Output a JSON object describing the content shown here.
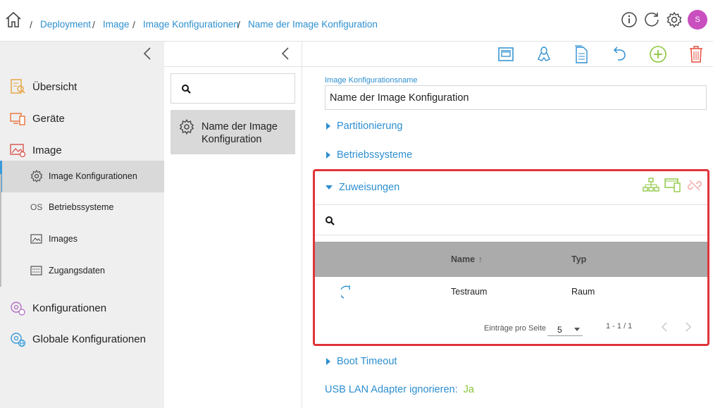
{
  "breadcrumb": {
    "items": [
      "Deployment",
      "Image",
      "Image Konfigurationen",
      "Name der Image Konfiguration"
    ],
    "separator": "/"
  },
  "header": {
    "avatar_initial": "S",
    "avatar_color": "#c94fbf"
  },
  "sidebar": {
    "items": [
      {
        "label": "Übersicht",
        "icon": "overview-icon"
      },
      {
        "label": "Geräte",
        "icon": "devices-icon"
      },
      {
        "label": "Image",
        "icon": "image-icon"
      },
      {
        "label": "Image Konfigurationen",
        "icon": "gear-config-icon",
        "sub": true,
        "active": true
      },
      {
        "label": "Betriebssysteme",
        "icon": "os-icon",
        "icon_text": "OS",
        "sub": true
      },
      {
        "label": "Images",
        "icon": "images-icon",
        "sub": true
      },
      {
        "label": "Zugangsdaten",
        "icon": "credentials-icon",
        "sub": true
      },
      {
        "label": "Konfigurationen",
        "icon": "configurations-icon"
      },
      {
        "label": "Globale Konfigurationen",
        "icon": "global-config-icon"
      }
    ]
  },
  "list": {
    "search_placeholder": "",
    "items": [
      {
        "label": "Name der Image Konfiguration"
      }
    ]
  },
  "toolbar": {
    "icons": [
      "network-icon",
      "linux-icon",
      "document-icon",
      "undo-icon",
      "add-icon",
      "delete-icon"
    ],
    "colors": {
      "blue": "#2d8fd0",
      "green": "#8cc63f",
      "red": "#e74c3c"
    }
  },
  "detail": {
    "name_label": "Image Konfigurationsname",
    "name_value": "Name der Image Konfiguration",
    "sections": {
      "partitionierung": "Partitionierung",
      "betriebssysteme": "Betriebssysteme",
      "zuweisungen": "Zuweisungen",
      "boot_timeout": "Boot Timeout"
    },
    "usb": {
      "label": "USB LAN Adapter ignorieren:",
      "value": "Ja"
    },
    "assignments": {
      "search_placeholder": "",
      "columns": {
        "name": "Name",
        "typ": "Typ"
      },
      "rows": [
        {
          "name": "Testraum",
          "typ": "Raum"
        }
      ],
      "pager": {
        "per_page_label": "Einträge pro Seite",
        "per_page_value": "5",
        "range": "1 - 1 / 1"
      }
    }
  }
}
